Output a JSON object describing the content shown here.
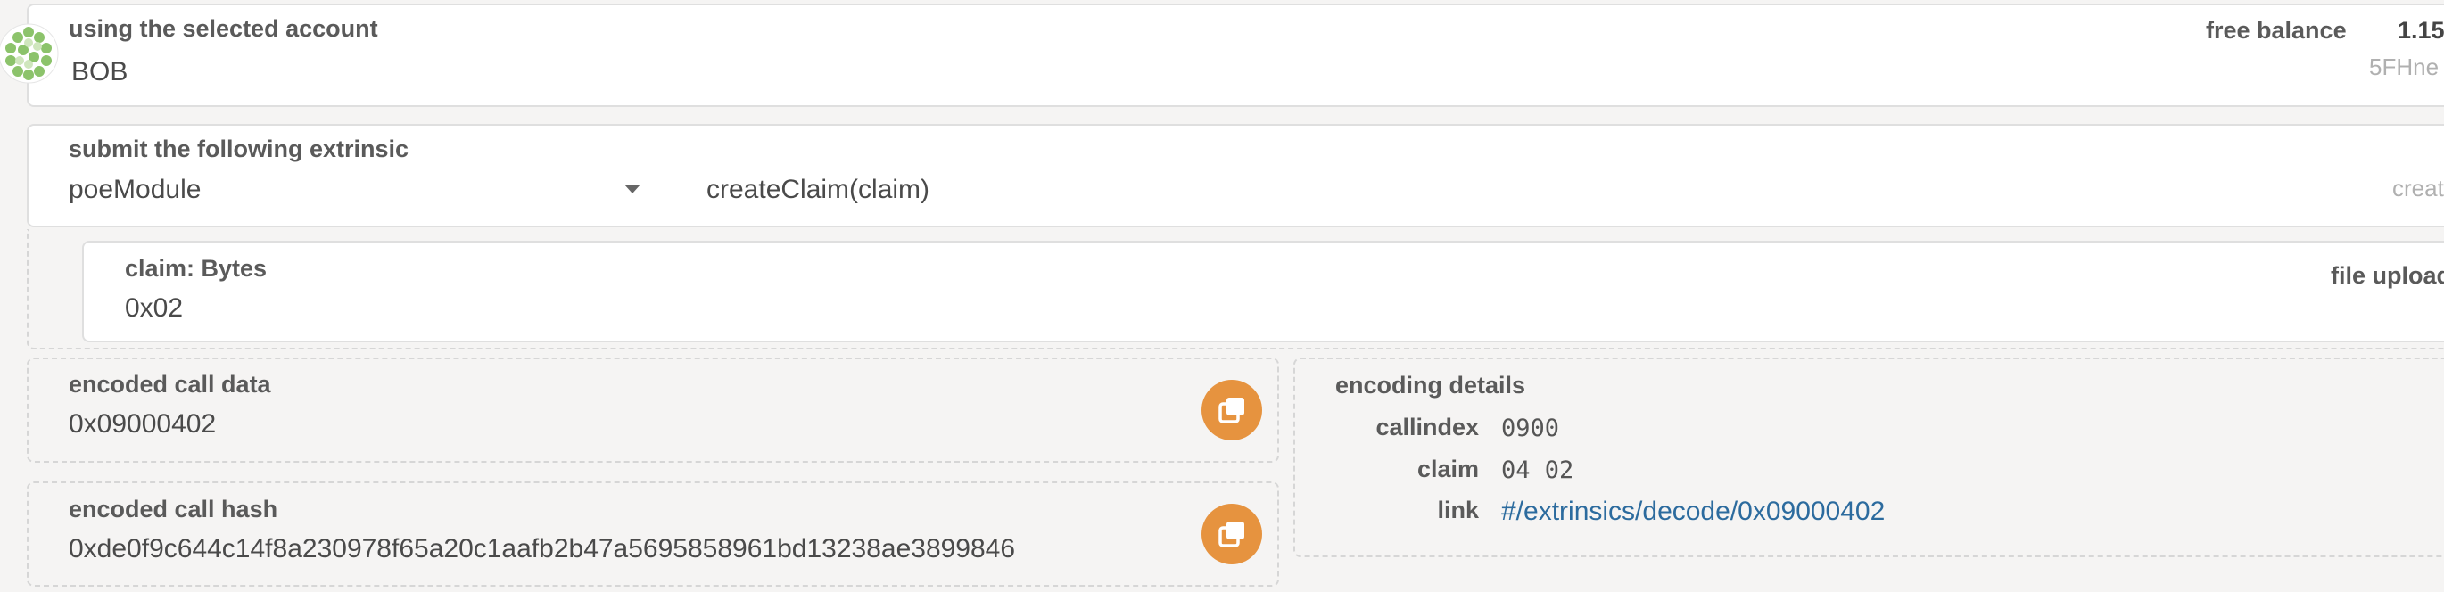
{
  "account": {
    "label": "using the selected account",
    "name": "BOB",
    "balance_label": "free balance",
    "balance_value": "1.15",
    "address_partial": "5FHne"
  },
  "extrinsic": {
    "label": "submit the following extrinsic",
    "module": "poeModule",
    "method": "createClaim(claim)",
    "right_hint": "creat"
  },
  "param": {
    "label": "claim: Bytes",
    "value": "0x02",
    "file_upload_label": "file upload"
  },
  "encoded_call_data": {
    "label": "encoded call data",
    "value": "0x09000402"
  },
  "encoded_call_hash": {
    "label": "encoded call hash",
    "value": "0xde0f9c644c14f8a230978f65a20c1aafb2b47a5695858961bd13238ae3899846"
  },
  "encoding_details": {
    "title": "encoding details",
    "callindex_label": "callindex",
    "callindex_value": "0900",
    "claim_label": "claim",
    "claim_value": "04 02",
    "link_label": "link",
    "link_value": "#/extrinsics/decode/0x09000402"
  },
  "colors": {
    "accent": "#e6933f",
    "link": "#2c6b9e",
    "identicon": "#8cc36b"
  }
}
